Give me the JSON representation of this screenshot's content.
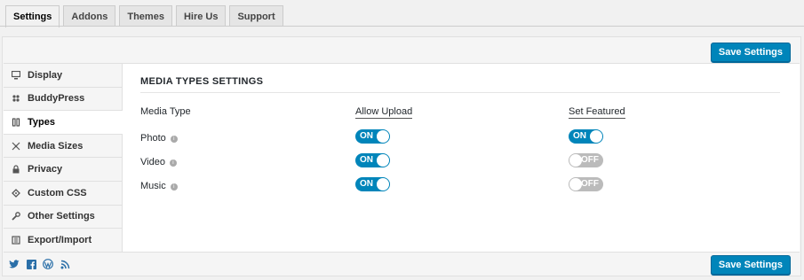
{
  "tabs": [
    "Settings",
    "Addons",
    "Themes",
    "Hire Us",
    "Support"
  ],
  "buttons": {
    "save": "Save Settings"
  },
  "sidebar": [
    {
      "label": "Display",
      "icon": "monitor-icon"
    },
    {
      "label": "BuddyPress",
      "icon": "buddypress-icon"
    },
    {
      "label": "Types",
      "icon": "types-icon"
    },
    {
      "label": "Media Sizes",
      "icon": "resize-icon"
    },
    {
      "label": "Privacy",
      "icon": "lock-icon"
    },
    {
      "label": "Custom CSS",
      "icon": "css-icon"
    },
    {
      "label": "Other Settings",
      "icon": "wrench-icon"
    },
    {
      "label": "Export/Import",
      "icon": "export-icon"
    }
  ],
  "section": {
    "title": "MEDIA TYPES SETTINGS",
    "headers": {
      "type": "Media Type",
      "upload": "Allow Upload",
      "featured": "Set Featured"
    },
    "rows": [
      {
        "name": "Photo",
        "upload": "ON",
        "featured": "ON"
      },
      {
        "name": "Video",
        "upload": "ON",
        "featured": "OFF"
      },
      {
        "name": "Music",
        "upload": "ON",
        "featured": "OFF"
      }
    ]
  },
  "social": [
    "twitter-icon",
    "facebook-icon",
    "wordpress-icon",
    "rss-icon"
  ],
  "colors": {
    "accent": "#0085ba",
    "toggle_off": "#bbbbbb"
  }
}
